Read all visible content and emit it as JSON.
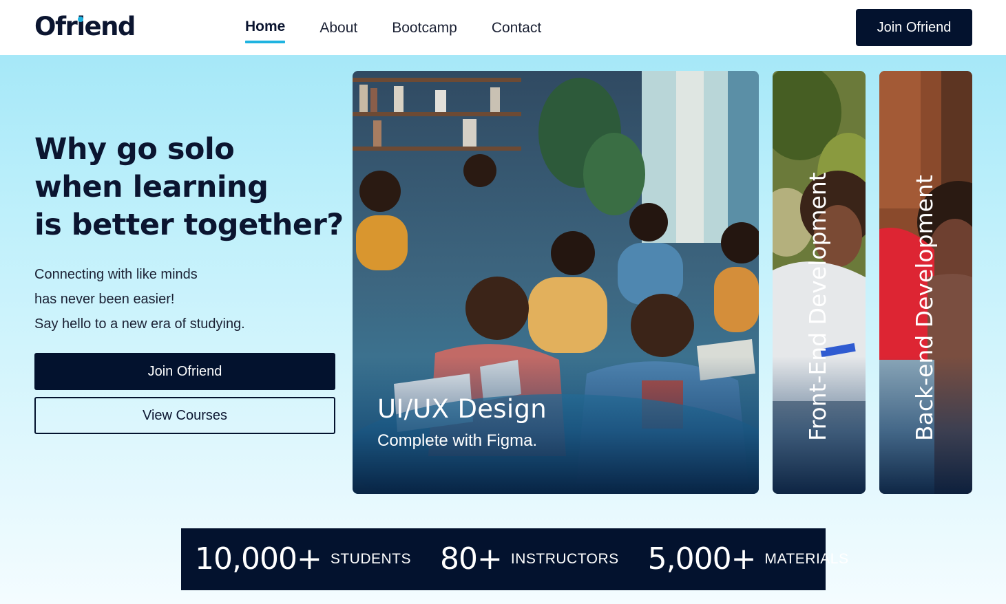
{
  "brand": {
    "logo_text_1": "Ofr",
    "logo_i": "i",
    "logo_text_2": "end",
    "accent": "#1fb3e0",
    "dark": "#03122e"
  },
  "nav": {
    "links": [
      {
        "label": "Home",
        "active": true
      },
      {
        "label": "About",
        "active": false
      },
      {
        "label": "Bootcamp",
        "active": false
      },
      {
        "label": "Contact",
        "active": false
      }
    ],
    "cta_label": "Join Ofriend"
  },
  "hero": {
    "title_lines": [
      "Why go solo",
      "when learning",
      "is better together?"
    ],
    "subtitle_lines": [
      "Connecting with like minds",
      "has never been easier!",
      "Say hello to a new era of studying."
    ],
    "primary_button": "Join Ofriend",
    "secondary_button": "View Courses"
  },
  "cards": [
    {
      "title": "UI/UX Design",
      "subtitle": "Complete with Figma.",
      "image": "students-studying-photo"
    },
    {
      "title": "Front-End Development",
      "image": "smiling-student-photo"
    },
    {
      "title": "Back-end Development",
      "image": "student-reading-photo"
    }
  ],
  "stats": [
    {
      "value": "10,000+",
      "label": "STUDENTS"
    },
    {
      "value": "80+",
      "label": "INSTRUCTORS"
    },
    {
      "value": "5,000+",
      "label": "MATERIALS"
    }
  ]
}
